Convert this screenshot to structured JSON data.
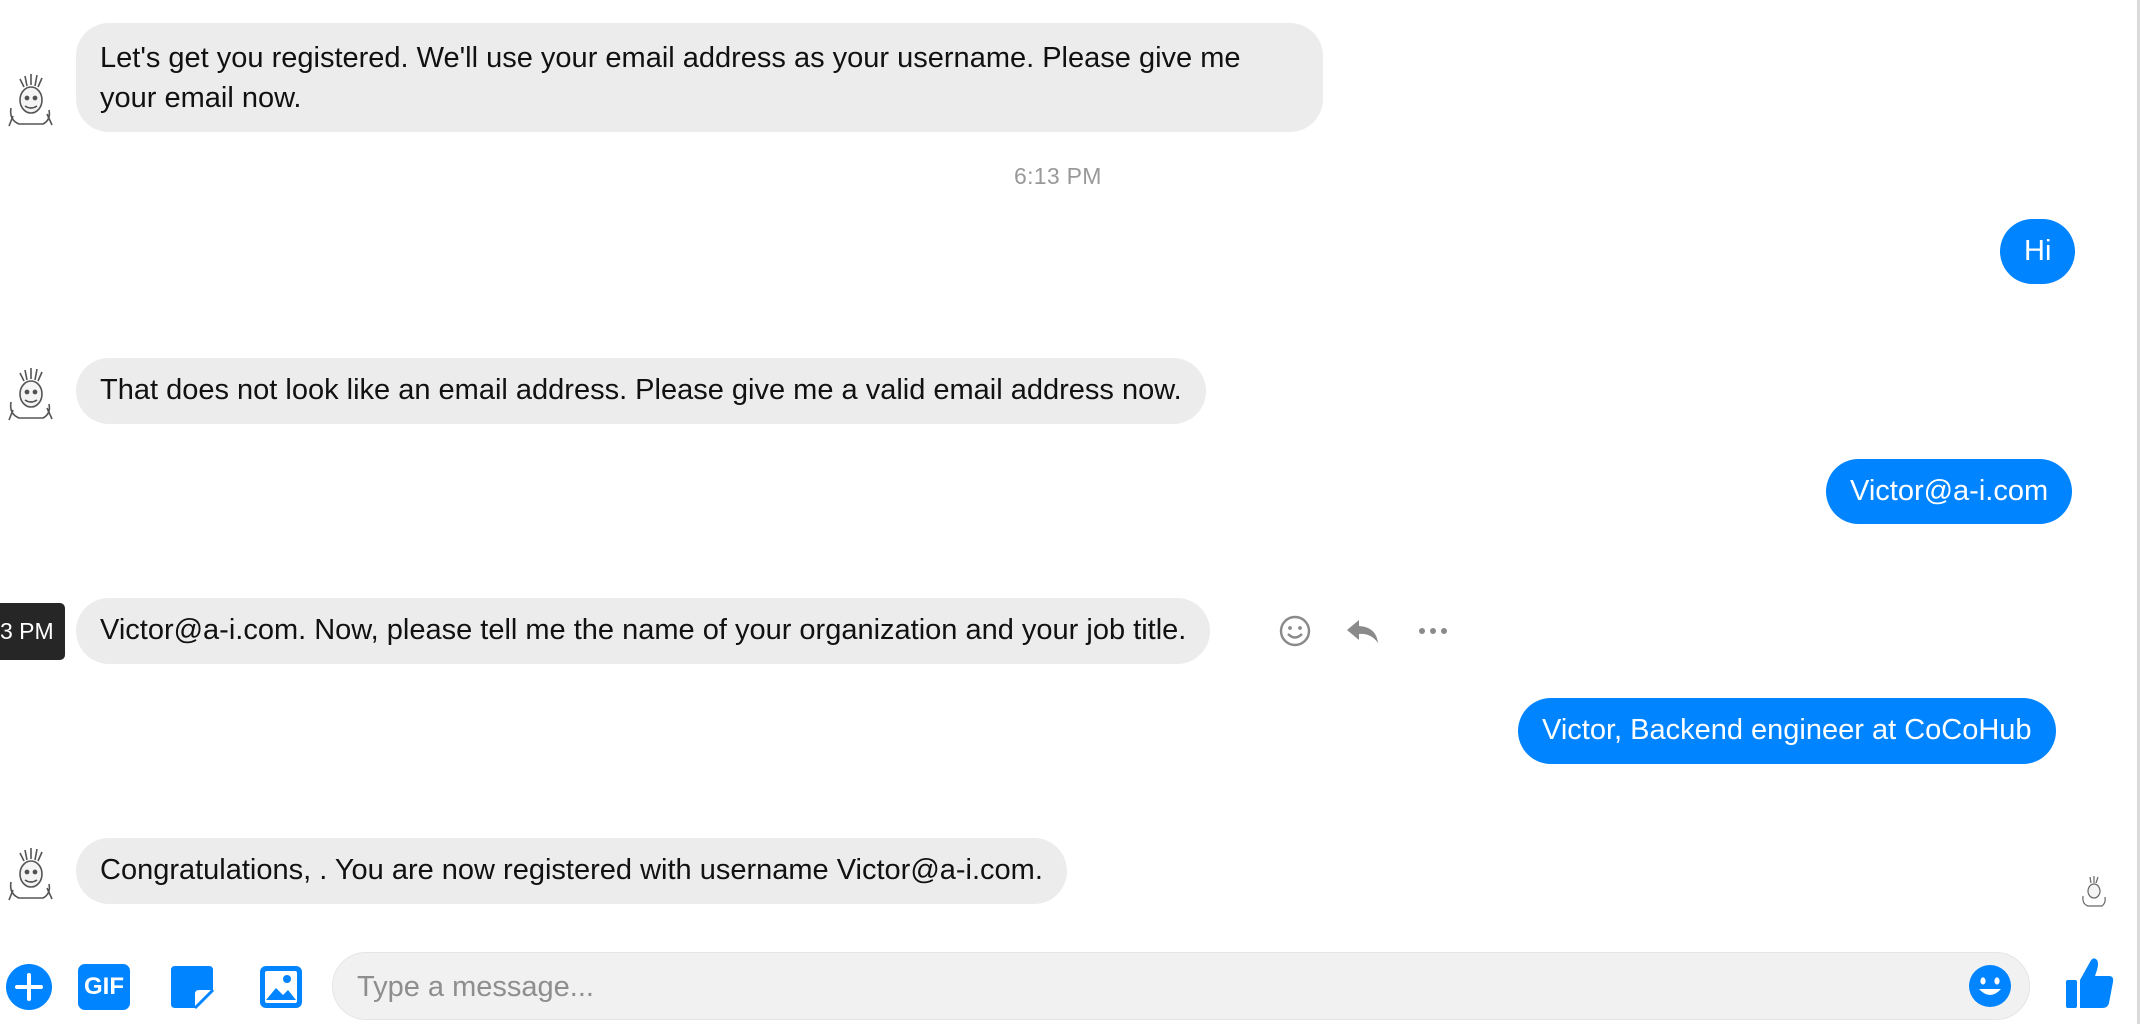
{
  "messages": [
    {
      "sender": "bot",
      "text": "Let's get you registered. We'll use your email address as your username. Please give me your email now."
    },
    {
      "sender": "user",
      "text": "Hi"
    },
    {
      "sender": "bot",
      "text": "That does not look like an email address. Please give me a valid email address now."
    },
    {
      "sender": "user",
      "text": "Victor@a-i.com"
    },
    {
      "sender": "bot",
      "text": "Victor@a-i.com. Now, please tell me the name of your organization and your job title."
    },
    {
      "sender": "user",
      "text": "Victor, Backend engineer at CoCoHub"
    },
    {
      "sender": "bot",
      "text": "Congratulations, . You are now registered with username Victor@a-i.com."
    }
  ],
  "timestamp_divider": "6:13 PM",
  "hover_tooltip": "3 PM",
  "message_actions": [
    "smiley-icon",
    "reply-icon",
    "more-icon"
  ],
  "composer": {
    "placeholder": "Type a message...",
    "value": "",
    "icons": [
      "plus-icon",
      "gif-icon",
      "sticker-icon",
      "photo-icon",
      "emoji-icon",
      "like-thumb-icon"
    ],
    "gif_label": "GIF"
  },
  "colors": {
    "accent": "#0084ff",
    "bot_bubble": "#ececec",
    "timestamp_text": "#999999"
  }
}
